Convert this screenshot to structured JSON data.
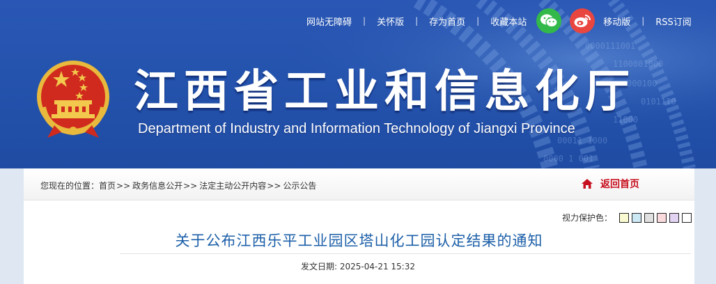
{
  "header": {
    "links": {
      "accessibility": "网站无障碍",
      "care_mode": "关怀版",
      "set_home": "存为首页",
      "bookmark": "收藏本站",
      "mobile": "移动版",
      "rss": "RSS订阅"
    },
    "separator": "|",
    "title_cn": "江西省工业和信息化厅",
    "title_en": "Department of Industry and Information Technology of Jiangxi Province",
    "colors": {
      "banner": "#2453ad",
      "wechat": "#33b94a",
      "weibo": "#e8463f"
    },
    "icons": [
      "wechat-icon",
      "weibo-icon",
      "national-emblem"
    ]
  },
  "breadcrumb": {
    "prefix": "您现在的位置：",
    "items": [
      "首页",
      "政务信息公开",
      "法定主动公开内容",
      "公示公告"
    ],
    "arrow": ">>",
    "home_label": "返回首页",
    "home_color": "#c7101f"
  },
  "eye_care": {
    "label": "视力保护色：",
    "swatches": [
      "#fafad2",
      "#cce8f4",
      "#e0e0e0",
      "#fadadd",
      "#e3d3f2",
      "#ffffff"
    ]
  },
  "article": {
    "title": "关于公布江西乐平工业园区塔山化工园认定结果的通知",
    "title_color": "#1c5fa8",
    "date": "发文日期: 2025-04-21 15:32"
  }
}
